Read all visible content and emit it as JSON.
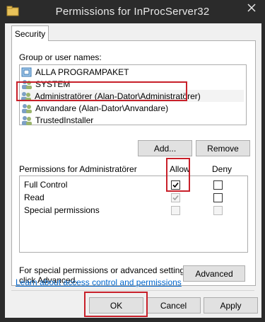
{
  "window": {
    "title": "Permissions for InProcServer32"
  },
  "tabs": [
    {
      "label": "Security"
    }
  ],
  "names": {
    "label": "Group or user names:",
    "items": [
      {
        "name": "ALLA PROGRAMPAKET",
        "icon": "package-group-icon"
      },
      {
        "name": "SYSTEM",
        "icon": "user-group-icon"
      },
      {
        "name": "Administratörer (Alan-Dator\\Administratörer)",
        "icon": "user-group-icon",
        "selected": true
      },
      {
        "name": "Anvandare (Alan-Dator\\Anvandare)",
        "icon": "user-group-icon"
      },
      {
        "name": "TrustedInstaller",
        "icon": "user-group-icon"
      }
    ]
  },
  "buttons": {
    "add": "Add...",
    "remove": "Remove",
    "advanced": "Advanced",
    "ok": "OK",
    "cancel": "Cancel",
    "apply": "Apply"
  },
  "permissions": {
    "header": "Permissions for Administratörer",
    "allow_header": "Allow",
    "deny_header": "Deny",
    "rows": [
      {
        "label": "Full Control",
        "allow": true,
        "deny": false,
        "allow_enabled": true,
        "deny_enabled": true
      },
      {
        "label": "Read",
        "allow": true,
        "deny": false,
        "allow_enabled": false,
        "deny_enabled": true
      },
      {
        "label": "Special permissions",
        "allow": false,
        "deny": false,
        "allow_enabled": false,
        "deny_enabled": false
      }
    ]
  },
  "advanced_text": "For special permissions or advanced settings,\nclick Advanced.",
  "advanced_text_lines": [
    "For special permissions or advanced settings,",
    "click Advanced."
  ],
  "link": "Learn about access control and permissions",
  "colors": {
    "highlight": "#c8202a",
    "link": "#0066cc",
    "titlebar": "#2b2b2b"
  }
}
